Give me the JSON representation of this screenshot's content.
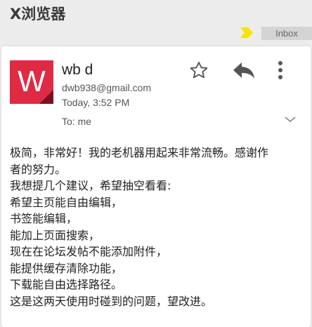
{
  "app": {
    "title": "X浏览器"
  },
  "labels": {
    "inbox": "Inbox"
  },
  "colors": {
    "avatar_bg": "#e02a43",
    "important_marker": "#f7e500"
  },
  "message": {
    "avatar_letter": "W",
    "sender_name": "wb d",
    "sender_email": "dwb938@gmail.com",
    "time": "Today, 3:52 PM",
    "to": "To: me",
    "body_lines": [
      "极简，非常好！我的老机器用起来非常流畅。感谢作",
      "者的努力。",
      "我想提几个建议，希望抽空看看:",
      "希望主页能自由编辑，",
      "书签能编辑，",
      "能加上页面搜索，",
      "现在在论坛发帖不能添加附件，",
      "能提供缓存清除功能，",
      "下载能自由选择路径。",
      "这是这两天使用时碰到的问题，望改进。"
    ]
  },
  "icons": {
    "star": "star-outline-icon",
    "reply": "reply-arrow-icon",
    "more": "vertical-dots-icon",
    "expand": "chevron-down-icon",
    "important": "importance-marker-icon"
  }
}
